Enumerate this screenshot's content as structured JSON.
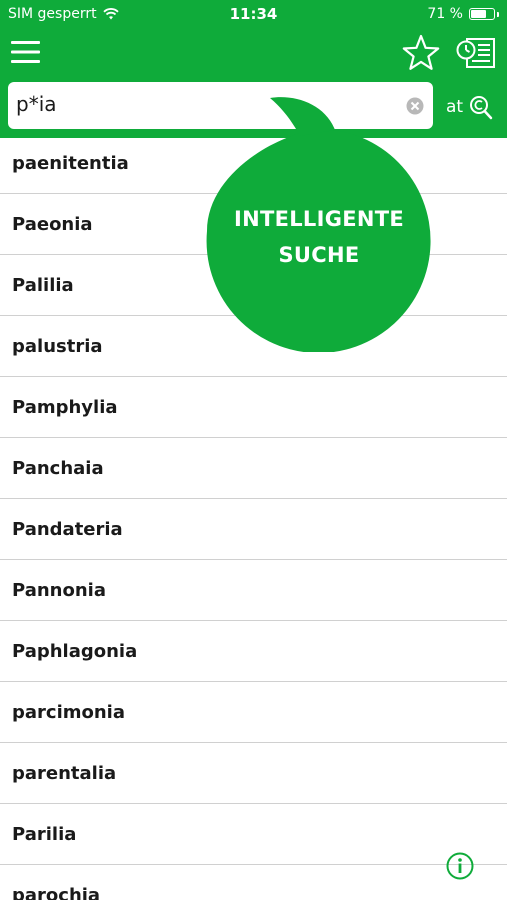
{
  "status_bar": {
    "carrier": "SIM gesperrt",
    "time": "11:34",
    "battery_text": "71 %",
    "battery_level": 0.71
  },
  "header": {
    "menu_icon": "menu-icon",
    "favorite_icon": "star-icon",
    "history_icon": "history-list-icon"
  },
  "search": {
    "value": "p*ia",
    "clear_icon": "clear-icon",
    "mode_icon": "at-search-icon"
  },
  "tooltip": {
    "line1": "INTELLIGENTE",
    "line2": "SUCHE"
  },
  "results": [
    "paenitentia",
    "Paeonia",
    "Palilia",
    "palustria",
    "Pamphylia",
    "Panchaia",
    "Pandateria",
    "Pannonia",
    "Paphlagonia",
    "parcimonia",
    "parentalia",
    "Parilia",
    "parochia"
  ],
  "info_icon": "info-icon",
  "colors": {
    "brand_green": "#0fab3a",
    "text": "#1a1a1a",
    "divider": "#d0d0d0"
  }
}
